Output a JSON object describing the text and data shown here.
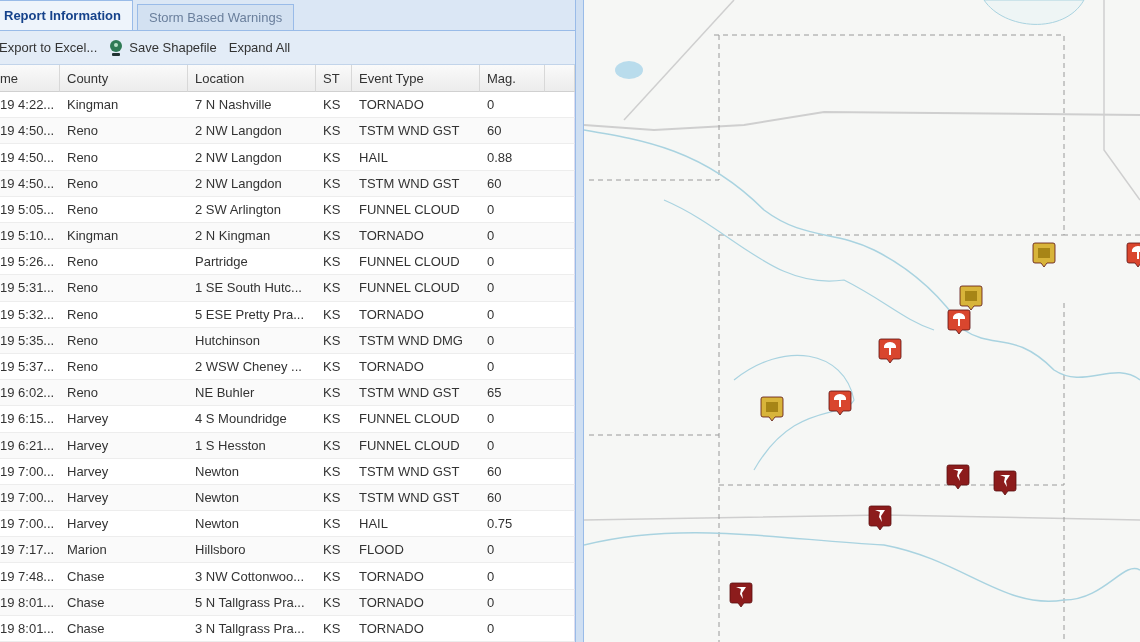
{
  "tabs": [
    {
      "label": "Report Information",
      "selected": true
    },
    {
      "label": "Storm Based Warnings",
      "selected": false
    }
  ],
  "toolbar": [
    {
      "label": "Export to Excel...",
      "kind": "text"
    },
    {
      "label": "Save Shapefile",
      "kind": "icon"
    },
    {
      "label": "Expand All",
      "kind": "text"
    }
  ],
  "table": {
    "columns": [
      "me",
      "County",
      "Location",
      "ST",
      "Event Type",
      "Mag."
    ],
    "rows": [
      [
        "19 4:22...",
        "Kingman",
        "7 N Nashville",
        "KS",
        "TORNADO",
        "0"
      ],
      [
        "19 4:50...",
        "Reno",
        "2 NW Langdon",
        "KS",
        "TSTM WND GST",
        "60"
      ],
      [
        "19 4:50...",
        "Reno",
        "2 NW Langdon",
        "KS",
        "HAIL",
        "0.88"
      ],
      [
        "19 4:50...",
        "Reno",
        "2 NW Langdon",
        "KS",
        "TSTM WND GST",
        "60"
      ],
      [
        "19 5:05...",
        "Reno",
        "2 SW Arlington",
        "KS",
        "FUNNEL CLOUD",
        "0"
      ],
      [
        "19 5:10...",
        "Kingman",
        "2 N Kingman",
        "KS",
        "TORNADO",
        "0"
      ],
      [
        "19 5:26...",
        "Reno",
        "Partridge",
        "KS",
        "FUNNEL CLOUD",
        "0"
      ],
      [
        "19 5:31...",
        "Reno",
        "1 SE South Hutc...",
        "KS",
        "FUNNEL CLOUD",
        "0"
      ],
      [
        "19 5:32...",
        "Reno",
        "5 ESE Pretty Pra...",
        "KS",
        "TORNADO",
        "0"
      ],
      [
        "19 5:35...",
        "Reno",
        "Hutchinson",
        "KS",
        "TSTM WND DMG",
        "0"
      ],
      [
        "19 5:37...",
        "Reno",
        "2 WSW Cheney ...",
        "KS",
        "TORNADO",
        "0"
      ],
      [
        "19 6:02...",
        "Reno",
        "NE Buhler",
        "KS",
        "TSTM WND GST",
        "65"
      ],
      [
        "19 6:15...",
        "Harvey",
        "4 S Moundridge",
        "KS",
        "FUNNEL CLOUD",
        "0"
      ],
      [
        "19 6:21...",
        "Harvey",
        "1 S Hesston",
        "KS",
        "FUNNEL CLOUD",
        "0"
      ],
      [
        "19 7:00...",
        "Harvey",
        "Newton",
        "KS",
        "TSTM WND GST",
        "60"
      ],
      [
        "19 7:00...",
        "Harvey",
        "Newton",
        "KS",
        "TSTM WND GST",
        "60"
      ],
      [
        "19 7:00...",
        "Harvey",
        "Newton",
        "KS",
        "HAIL",
        "0.75"
      ],
      [
        "19 7:17...",
        "Marion",
        "Hillsboro",
        "KS",
        "FLOOD",
        "0"
      ],
      [
        "19 7:48...",
        "Chase",
        "3 NW Cottonwoo...",
        "KS",
        "TORNADO",
        "0"
      ],
      [
        "19 8:01...",
        "Chase",
        "5 N Tallgrass Pra...",
        "KS",
        "TORNADO",
        "0"
      ],
      [
        "19 8:01...",
        "Chase",
        "3 N Tallgrass Pra...",
        "KS",
        "TORNADO",
        "0"
      ]
    ]
  }
}
